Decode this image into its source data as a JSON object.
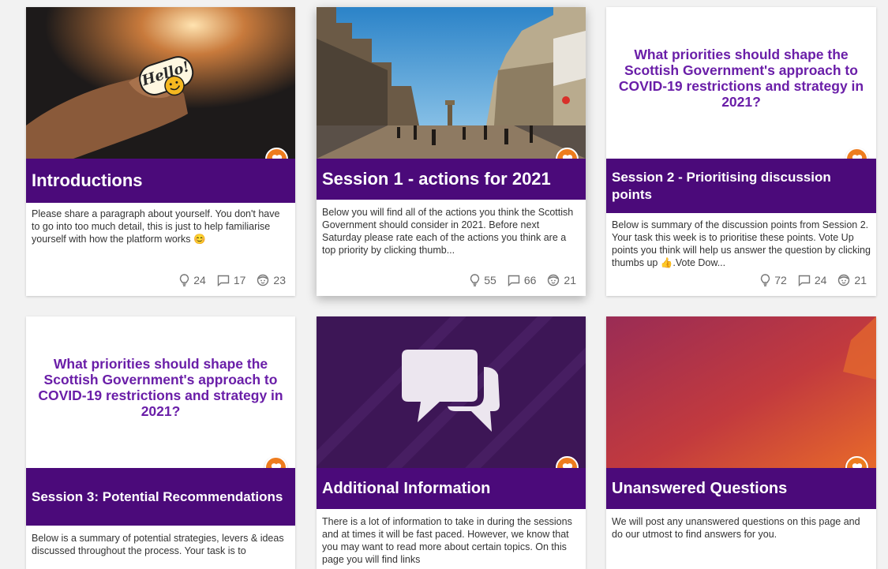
{
  "colors": {
    "title_bar": "#4b0a7a",
    "heart": "#ee7c1e",
    "question_text": "#6a1ea8"
  },
  "cards": [
    {
      "title": "Introductions",
      "image": "hello-sticker-photo",
      "description": "Please share a paragraph about yourself. You don't have to go into too much detail, this is just to help familiarise yourself with how the platform works 😊",
      "ideas": "24",
      "comments": "17",
      "participants": "23"
    },
    {
      "title": "Session 1 - actions for 2021",
      "image": "city-street-photo",
      "description": "Below you will find all of the actions you think the Scottish Government should consider in 2021. Before next Saturday please rate each of the actions you think are a top priority by clicking thumb...",
      "ideas": "55",
      "comments": "66",
      "participants": "21"
    },
    {
      "title": "Session 2 - Prioritising discussion points",
      "image_text": "What priorities should shape the Scottish Government's approach to COVID-19 restrictions and strategy in 2021?",
      "description": "Below is summary of the discussion points from Session 2. Your task this week is to prioritise these points. Vote Up points you think will help us answer the question by clicking thumbs up 👍.Vote Dow...",
      "ideas": "72",
      "comments": "24",
      "participants": "21"
    },
    {
      "title": "Session 3: Potential Recommendations",
      "image_text": "What priorities should shape the Scottish Government's approach to COVID-19 restrictions and strategy in 2021?",
      "description": "Below is a summary of potential strategies, levers & ideas discussed throughout the process. Your task is to"
    },
    {
      "title": "Additional Information",
      "image": "speech-bubbles-graphic",
      "description": "There is a lot of information to take in during the sessions and at times it will be fast paced. However, we know that you may want to read more about certain topics. On this page you will find links"
    },
    {
      "title": "Unanswered Questions",
      "image": "orange-gradient-graphic",
      "description": "We will post any unanswered questions on this page and do our utmost to find answers for you."
    }
  ]
}
